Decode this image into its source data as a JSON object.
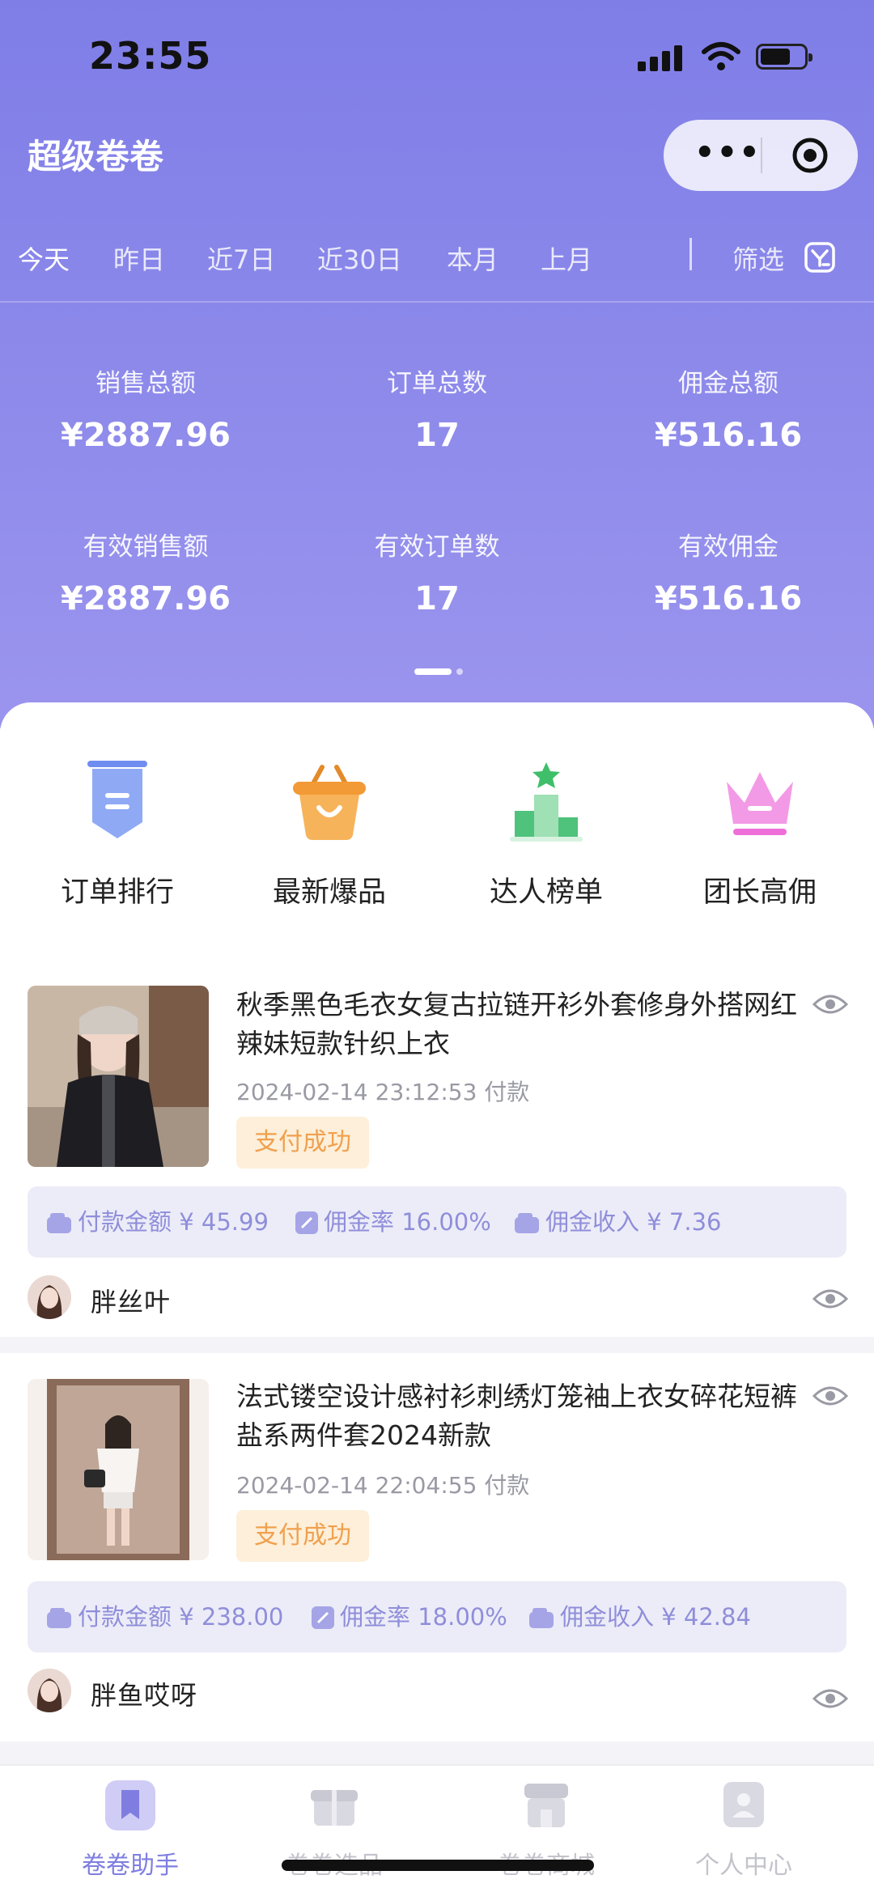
{
  "status_bar": {
    "time": "23:55"
  },
  "header": {
    "title": "超级卷卷"
  },
  "date_tabs": [
    "今天",
    "昨日",
    "近7日",
    "近30日",
    "本月",
    "上月"
  ],
  "filter_label": "筛选",
  "stats": [
    {
      "label": "销售总额",
      "value": "¥2887.96"
    },
    {
      "label": "订单总数",
      "value": "17"
    },
    {
      "label": "佣金总额",
      "value": "¥516.16"
    },
    {
      "label": "有效销售额",
      "value": "¥2887.96"
    },
    {
      "label": "有效订单数",
      "value": "17"
    },
    {
      "label": "有效佣金",
      "value": "¥516.16"
    }
  ],
  "quick_actions": [
    {
      "label": "订单排行",
      "icon": "ranking-badge-icon",
      "color": "#6f8df0"
    },
    {
      "label": "最新爆品",
      "icon": "shopping-basket-icon",
      "color": "#f5a23c"
    },
    {
      "label": "达人榜单",
      "icon": "podium-icon",
      "color": "#52c27a"
    },
    {
      "label": "团长高佣",
      "icon": "crown-icon",
      "color": "#ee6fd8"
    }
  ],
  "orders": [
    {
      "title": "秋季黑色毛衣女复古拉链开衫外套修身外搭网红辣妹短款针织上衣",
      "time": "2024-02-14 23:12:53 付款",
      "status": "支付成功",
      "pay_label": "付款金额",
      "pay_amount": "¥ 45.99",
      "rate_label": "佣金率",
      "rate": "16.00%",
      "income_label": "佣金收入",
      "income": "¥ 7.36",
      "user": "胖丝叶"
    },
    {
      "title": "法式镂空设计感衬衫刺绣灯笼袖上衣女碎花短裤盐系两件套2024新款",
      "time": "2024-02-14 22:04:55 付款",
      "status": "支付成功",
      "pay_label": "付款金额",
      "pay_amount": "¥ 238.00",
      "rate_label": "佣金率",
      "rate": "18.00%",
      "income_label": "佣金收入",
      "income": "¥ 42.84",
      "user": "胖鱼哎呀"
    }
  ],
  "bottom_nav": [
    {
      "label": "卷卷助手",
      "active": true
    },
    {
      "label": "卷卷选品",
      "active": false
    },
    {
      "label": "卷卷商城",
      "active": false
    },
    {
      "label": "个人中心",
      "active": false
    }
  ],
  "colors": {
    "header_bg": "#8684e8",
    "accent": "#7f7ee0",
    "badge_text": "#f0a04e",
    "badge_bg": "#fdefd9"
  }
}
